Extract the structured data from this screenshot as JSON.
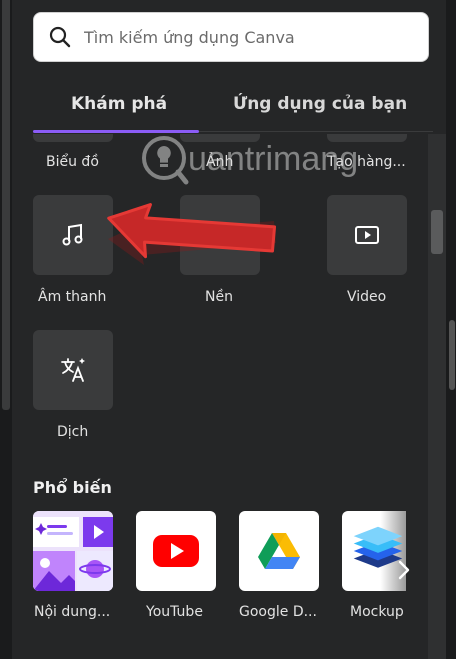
{
  "search": {
    "placeholder": "Tìm kiếm ứng dụng Canva"
  },
  "tabs": [
    {
      "label": "Khám phá",
      "active": true
    },
    {
      "label": "Ứng dụng của bạn",
      "active": false
    }
  ],
  "apps_top_row": [
    {
      "label": "Biểu đồ"
    },
    {
      "label": "Ảnh"
    },
    {
      "label": "Tạo hàng..."
    }
  ],
  "apps": [
    {
      "label": "Âm thanh",
      "icon": "music-note-icon"
    },
    {
      "label": "Nền",
      "icon": "stripes-icon"
    },
    {
      "label": "Video",
      "icon": "video-play-icon"
    },
    {
      "label": "Dịch",
      "icon": "translate-icon"
    }
  ],
  "popular": {
    "title": "Phổ biến",
    "items": [
      {
        "label": "Nội dung...",
        "icon": "magic-media-icon"
      },
      {
        "label": "YouTube",
        "icon": "youtube-icon"
      },
      {
        "label": "Google D...",
        "icon": "google-drive-icon"
      },
      {
        "label": "Mockup",
        "icon": "mockups-icon"
      }
    ]
  },
  "watermark": {
    "text": "uantrimang"
  },
  "colors": {
    "background": "#252627",
    "tile": "#3a3b3c",
    "accent": "#8b5cf6",
    "annotation_arrow": "#e53935"
  }
}
